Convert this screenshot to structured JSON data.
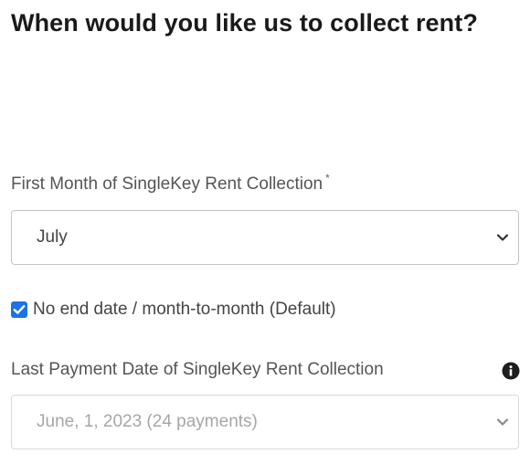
{
  "page": {
    "title": "When would you like us to collect rent?"
  },
  "first_month": {
    "label": "First Month of SingleKey Rent Collection",
    "required_marker": "*",
    "selected_value": "July",
    "icon": "chevron-down-icon"
  },
  "no_end_date": {
    "label": "No end date / month-to-month (Default)",
    "checked": true,
    "color": "#1a73e8"
  },
  "last_payment": {
    "label": "Last Payment Date of SingleKey Rent Collection",
    "info_icon": "info-icon",
    "selected_value": "June, 1, 2023 (24 payments)",
    "disabled": true,
    "icon": "chevron-down-icon"
  }
}
